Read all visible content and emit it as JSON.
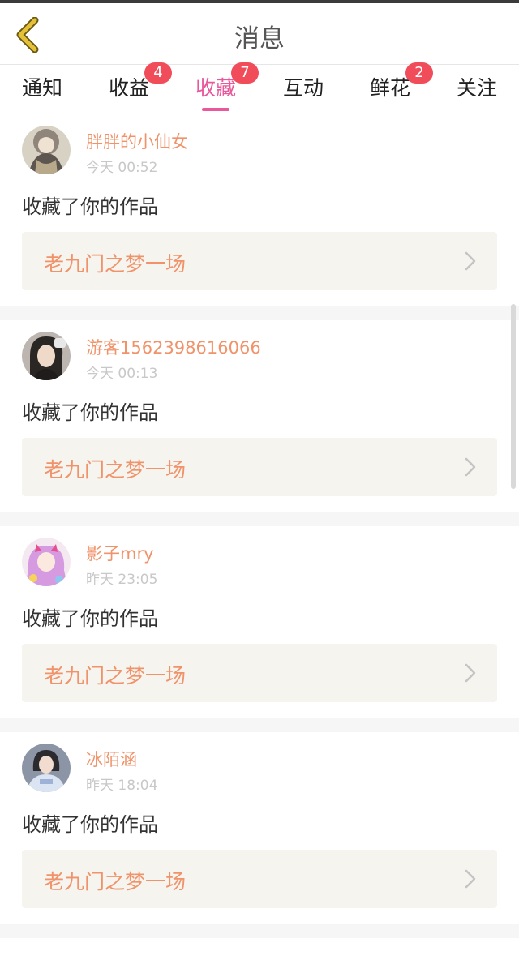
{
  "header": {
    "title": "消息",
    "back_icon": "chevron-left-icon",
    "back_color": "#e5c13a"
  },
  "tabs": [
    {
      "label": "通知",
      "badge": ""
    },
    {
      "label": "收益",
      "badge": "4"
    },
    {
      "label": "收藏",
      "badge": "7",
      "active": true
    },
    {
      "label": "互动",
      "badge": ""
    },
    {
      "label": "鲜花",
      "badge": "2"
    },
    {
      "label": "关注",
      "badge": ""
    }
  ],
  "colors": {
    "accent": "#e8589b",
    "username": "#f0936a",
    "badge": "#f04c5a",
    "work_bg": "#f5f4ef"
  },
  "notifications": [
    {
      "username": "胖胖的小仙女",
      "time": "今天 00:52",
      "action": "收藏了你的作品",
      "work_title": "老九门之梦一场",
      "avatar": "avatar-1"
    },
    {
      "username": "游客1562398616066",
      "time": "今天 00:13",
      "action": "收藏了你的作品",
      "work_title": "老九门之梦一场",
      "avatar": "avatar-2"
    },
    {
      "username": "影子mry",
      "time": "昨天 23:05",
      "action": "收藏了你的作品",
      "work_title": "老九门之梦一场",
      "avatar": "avatar-3"
    },
    {
      "username": "冰陌涵",
      "time": "昨天 18:04",
      "action": "收藏了你的作品",
      "work_title": "老九门之梦一场",
      "avatar": "avatar-4"
    }
  ]
}
